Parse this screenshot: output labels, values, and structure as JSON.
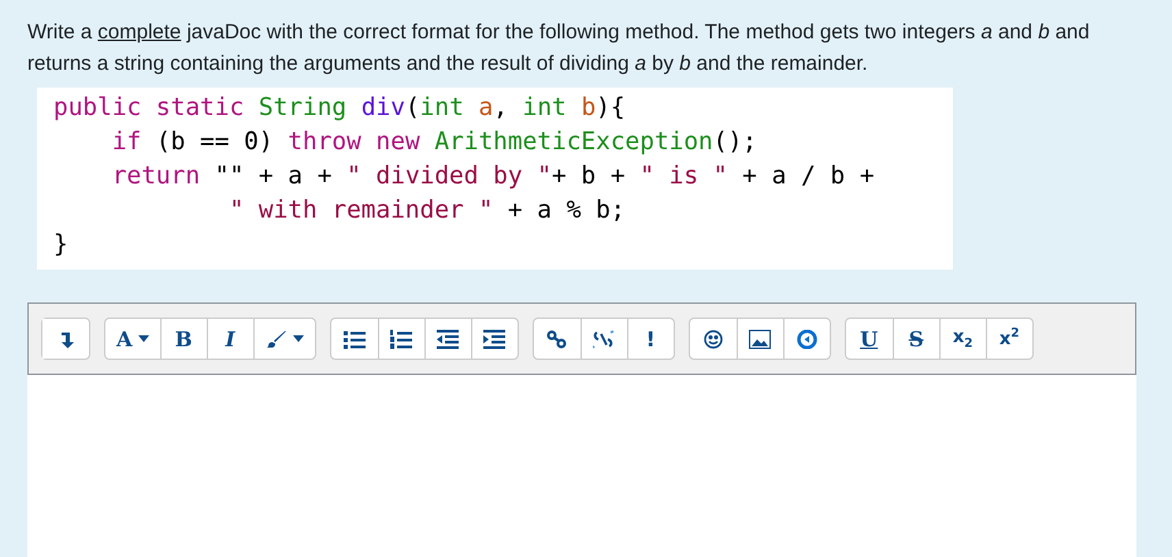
{
  "prompt": {
    "before": "Write a ",
    "underlined": "complete",
    "after": " javaDoc with the correct format for the following method.  The method gets two integers *a* and *b* and returns a string containing the arguments and the result of dividing *a* by *b* and the remainder."
  },
  "code_lines": [
    [
      {
        "kind": "keyword",
        "text": "public static "
      },
      {
        "kind": "type",
        "text": "String "
      },
      {
        "kind": "method",
        "text": "div"
      },
      {
        "kind": "plain",
        "text": "("
      },
      {
        "kind": "type",
        "text": "int "
      },
      {
        "kind": "param",
        "text": "a"
      },
      {
        "kind": "plain",
        "text": ", "
      },
      {
        "kind": "type",
        "text": "int "
      },
      {
        "kind": "param",
        "text": "b"
      },
      {
        "kind": "plain",
        "text": "){"
      }
    ],
    [
      {
        "kind": "keyword",
        "text": "    if "
      },
      {
        "kind": "plain",
        "text": "(b == 0) "
      },
      {
        "kind": "keyword",
        "text": "throw new "
      },
      {
        "kind": "type",
        "text": "ArithmeticException"
      },
      {
        "kind": "plain",
        "text": "();"
      }
    ],
    [
      {
        "kind": "keyword",
        "text": "    return "
      },
      {
        "kind": "plain",
        "text": "\"\" + a + "
      },
      {
        "kind": "string",
        "text": "\" divided by \""
      },
      {
        "kind": "plain",
        "text": "+ b + "
      },
      {
        "kind": "string",
        "text": "\" is \""
      },
      {
        "kind": "plain",
        "text": " + a / b +"
      }
    ],
    [
      {
        "kind": "string",
        "text": "            \" with remainder \""
      },
      {
        "kind": "plain",
        "text": " + a % b;"
      }
    ],
    [
      {
        "kind": "plain",
        "text": "}"
      }
    ]
  ],
  "toolbar": [
    [
      {
        "kind": "collapse"
      }
    ],
    [
      {
        "kind": "font",
        "label": "A"
      },
      {
        "kind": "bold",
        "label": "B"
      },
      {
        "kind": "italic",
        "label": "I"
      },
      {
        "kind": "brush"
      }
    ],
    [
      {
        "kind": "bullets"
      },
      {
        "kind": "numbers"
      },
      {
        "kind": "outdent"
      },
      {
        "kind": "indent"
      }
    ],
    [
      {
        "kind": "link"
      },
      {
        "kind": "unlink"
      },
      {
        "kind": "text",
        "label": "!"
      }
    ],
    [
      {
        "kind": "emoji"
      },
      {
        "kind": "image"
      },
      {
        "kind": "media"
      }
    ],
    [
      {
        "kind": "underline",
        "label": "U"
      },
      {
        "kind": "strike",
        "label": "S"
      },
      {
        "kind": "sub",
        "label": "x",
        "script": "2"
      },
      {
        "kind": "sup",
        "label": "x",
        "script": "2"
      }
    ]
  ]
}
